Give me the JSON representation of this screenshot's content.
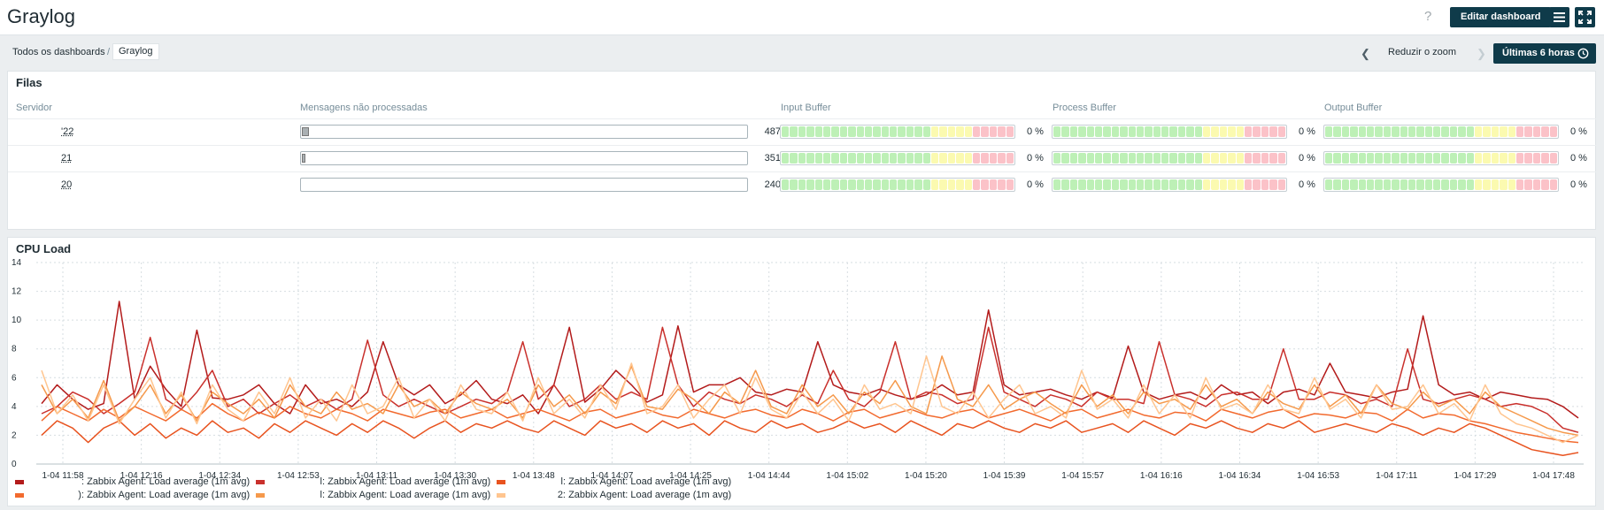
{
  "app": {
    "title": "Graylog"
  },
  "header": {
    "edit_label": "Editar dashboard",
    "help_label": "?"
  },
  "breadcrumb": {
    "root": "Todos os dashboards",
    "separator": "/",
    "current": "Graylog"
  },
  "timebar": {
    "zoom_label": "Reduzir o zoom",
    "range_label": "Últimas 6 horas"
  },
  "queues": {
    "title": "Filas",
    "headers": {
      "server": "Servidor",
      "messages": "Mensagens não processadas",
      "input": "Input Buffer",
      "process": "Process Buffer",
      "output": "Output Buffer"
    },
    "rows": [
      {
        "server": "'22",
        "messages": 487,
        "messages_label": "487",
        "input": "0 %",
        "process": "0 %",
        "output": "0 %",
        "fill_fraction": 0.015
      },
      {
        "server": "21",
        "messages": 351,
        "messages_label": "351",
        "input": "0 %",
        "process": "0 %",
        "output": "0 %",
        "fill_fraction": 0.008
      },
      {
        "server": "20",
        "messages": 240,
        "messages_label": "240",
        "input": "0 %",
        "process": "0 %",
        "output": "0 %",
        "fill_fraction": 0.0
      }
    ]
  },
  "cpu": {
    "title": "CPU Load",
    "legend": [
      {
        "prefix": ":",
        "text": "Zabbix Agent: Load average (1m avg)",
        "color": "#b31b1b"
      },
      {
        "prefix": "l:",
        "text": "Zabbix Agent: Load average (1m avg)",
        "color": "#c9302c"
      },
      {
        "prefix": "l:",
        "text": "Zabbix Agent: Load average (1m avg)",
        "color": "#e8531f"
      },
      {
        "prefix": "):",
        "text": "Zabbix Agent: Load average (1m avg)",
        "color": "#f26a2e"
      },
      {
        "prefix": "l:",
        "text": "Zabbix Agent: Load average (1m avg)",
        "color": "#f5994b"
      },
      {
        "prefix": "2:",
        "text": "Zabbix Agent: Load average (1m avg)",
        "color": "#ffc58f"
      }
    ]
  },
  "chart_data": {
    "type": "line",
    "ylim": [
      0,
      14
    ],
    "yticks": [
      "0",
      "2",
      "4",
      "6",
      "8",
      "10",
      "12",
      "14"
    ],
    "xticks": [
      "1-04 11:58",
      "1-04 12:16",
      "1-04 12:34",
      "1-04 12:53",
      "1-04 13:11",
      "1-04 13:30",
      "1-04 13:48",
      "1-04 14:07",
      "1-04 14:25",
      "1-04 14:44",
      "1-04 15:02",
      "1-04 15:20",
      "1-04 15:39",
      "1-04 15:57",
      "1-04 16:16",
      "1-04 16:34",
      "1-04 16:53",
      "1-04 17:11",
      "1-04 17:29",
      "1-04 17:48"
    ],
    "grid": true,
    "series": [
      {
        "color": "#b31b1b",
        "values": [
          4.2,
          5.5,
          4.5,
          3.8,
          4.2,
          11.3,
          4.5,
          6.8,
          5.2,
          4.0,
          9.3,
          4.6,
          4.5,
          4.8,
          5.5,
          4.2,
          3.5,
          5.5,
          4.2,
          4.5,
          4.0,
          5.0,
          8.5,
          5.5,
          4.8,
          5.5,
          4.2,
          4.8,
          5.8,
          4.5,
          4.2,
          4.8,
          3.5,
          5.5,
          9.5,
          4.3,
          5.2,
          6.5,
          5.5,
          4.3,
          4.8,
          9.6,
          5.0,
          5.5,
          5.5,
          6.0,
          5.0,
          4.8,
          5.2,
          5.0,
          8.5,
          5.5,
          5.0,
          4.8,
          5.2,
          4.8,
          4.5,
          4.8,
          5.5,
          4.8,
          5.0,
          10.7,
          5.5,
          4.8,
          5.0,
          5.2,
          4.8,
          4.5,
          5.0,
          4.6,
          8.2,
          5.0,
          4.5,
          4.8,
          5.0,
          4.5,
          5.5,
          4.8,
          5.0,
          4.2,
          5.0,
          5.2,
          4.8,
          7.0,
          5.0,
          4.8,
          4.6,
          5.0,
          5.2,
          10.3,
          5.5,
          4.8,
          5.0,
          4.5,
          5.0,
          4.8,
          4.6,
          4.5,
          4.0,
          3.2
        ]
      },
      {
        "color": "#c9302c",
        "values": [
          3.5,
          4.0,
          5.0,
          4.5,
          3.5,
          4.2,
          5.0,
          8.8,
          4.5,
          3.8,
          5.0,
          6.5,
          4.0,
          4.5,
          3.5,
          4.2,
          4.8,
          4.0,
          4.5,
          3.8,
          4.5,
          8.6,
          4.8,
          4.0,
          4.5,
          4.0,
          3.5,
          4.0,
          4.5,
          4.2,
          5.0,
          8.5,
          4.5,
          5.5,
          4.0,
          4.5,
          5.5,
          4.5,
          5.0,
          4.5,
          9.5,
          5.5,
          4.0,
          5.0,
          4.5,
          4.2,
          4.8,
          4.5,
          4.0,
          4.8,
          4.2,
          6.5,
          4.5,
          4.0,
          5.0,
          8.5,
          4.5,
          5.0,
          4.8,
          4.2,
          4.5,
          9.5,
          5.0,
          4.5,
          4.0,
          4.8,
          4.5,
          4.0,
          5.0,
          4.5,
          4.5,
          4.2,
          8.5,
          4.8,
          4.5,
          4.0,
          4.8,
          5.0,
          4.5,
          4.5,
          8.0,
          4.5,
          4.5,
          5.0,
          4.8,
          4.2,
          4.5,
          4.0,
          8.0,
          4.5,
          4.2,
          4.5,
          4.8,
          4.5,
          4.0,
          4.2,
          4.0,
          3.5,
          2.5,
          2.2
        ]
      },
      {
        "color": "#e8531f",
        "values": [
          2.0,
          3.0,
          2.5,
          1.5,
          2.5,
          3.0,
          2.0,
          2.8,
          1.8,
          2.5,
          2.0,
          3.0,
          2.2,
          2.5,
          1.8,
          2.8,
          2.2,
          3.0,
          2.5,
          2.0,
          2.8,
          2.2,
          3.0,
          2.5,
          1.8,
          2.5,
          3.0,
          2.2,
          2.8,
          2.5,
          3.0,
          2.5,
          2.2,
          3.0,
          2.5,
          2.0,
          3.0,
          2.5,
          2.8,
          2.2,
          3.0,
          2.5,
          2.8,
          2.0,
          3.0,
          2.5,
          2.2,
          3.0,
          2.5,
          2.8,
          2.2,
          2.5,
          3.0,
          2.5,
          2.8,
          2.2,
          3.0,
          2.5,
          2.0,
          2.8,
          2.5,
          3.0,
          2.5,
          2.2,
          2.8,
          2.5,
          3.0,
          2.2,
          2.5,
          2.8,
          2.2,
          3.0,
          2.5,
          2.0,
          2.8,
          2.5,
          3.0,
          2.5,
          2.2,
          2.8,
          2.5,
          3.0,
          2.2,
          2.5,
          2.8,
          2.5,
          2.2,
          2.8,
          2.5,
          2.0,
          2.5,
          2.2,
          2.8,
          2.5,
          2.0,
          1.5,
          1.0,
          0.8,
          0.6,
          0.8
        ]
      },
      {
        "color": "#f26a2e",
        "values": [
          3.0,
          4.0,
          3.5,
          3.0,
          3.8,
          3.2,
          4.0,
          3.5,
          3.0,
          3.8,
          3.2,
          4.2,
          3.5,
          3.0,
          3.6,
          3.2,
          4.0,
          3.5,
          3.2,
          3.8,
          3.5,
          3.0,
          3.8,
          3.5,
          3.2,
          3.6,
          3.8,
          3.2,
          3.5,
          3.8,
          3.2,
          3.5,
          3.8,
          3.4,
          3.0,
          3.6,
          3.8,
          3.2,
          3.5,
          3.8,
          3.4,
          3.2,
          3.8,
          3.5,
          3.2,
          3.6,
          3.8,
          3.4,
          3.2,
          3.8,
          3.5,
          3.0,
          3.6,
          3.8,
          3.2,
          3.5,
          3.8,
          3.4,
          3.2,
          3.6,
          3.8,
          3.2,
          3.5,
          3.8,
          3.4,
          3.0,
          3.6,
          3.8,
          3.2,
          3.5,
          3.8,
          3.4,
          3.2,
          3.6,
          3.5,
          3.0,
          3.8,
          3.5,
          3.2,
          3.6,
          3.8,
          3.2,
          3.5,
          3.4,
          3.2,
          3.6,
          3.5,
          3.0,
          3.8,
          3.2,
          3.5,
          3.4,
          3.0,
          2.8,
          2.5,
          2.2,
          2.0,
          1.8,
          1.6,
          1.5
        ]
      },
      {
        "color": "#f5994b",
        "values": [
          5.5,
          3.5,
          4.5,
          3.2,
          5.8,
          3.0,
          4.0,
          5.5,
          3.5,
          4.8,
          3.0,
          5.0,
          4.2,
          3.5,
          4.5,
          3.2,
          5.5,
          4.0,
          3.5,
          5.0,
          3.8,
          4.2,
          3.5,
          5.5,
          4.0,
          4.5,
          3.5,
          5.0,
          4.2,
          3.8,
          4.5,
          3.2,
          5.5,
          4.0,
          4.8,
          3.5,
          5.0,
          4.2,
          6.8,
          4.0,
          3.8,
          5.2,
          4.5,
          3.5,
          5.0,
          4.2,
          6.5,
          4.0,
          3.5,
          5.5,
          4.0,
          4.8,
          3.5,
          5.0,
          4.2,
          5.8,
          4.0,
          3.5,
          7.5,
          4.5,
          4.0,
          5.5,
          3.8,
          4.5,
          5.0,
          4.2,
          3.5,
          5.5,
          4.0,
          4.8,
          3.5,
          5.0,
          4.2,
          4.5,
          3.8,
          5.5,
          4.0,
          4.5,
          3.5,
          5.0,
          4.2,
          3.8,
          5.5,
          4.0,
          4.8,
          3.5,
          5.5,
          4.2,
          3.8,
          5.0,
          4.0,
          4.5,
          3.5,
          5.0,
          4.0,
          3.5,
          3.0,
          2.5,
          2.2,
          2.0
        ]
      },
      {
        "color": "#ffc58f",
        "values": [
          6.5,
          3.5,
          4.8,
          3.0,
          5.5,
          2.8,
          4.5,
          6.0,
          3.2,
          5.0,
          2.8,
          5.5,
          3.8,
          3.0,
          5.0,
          3.5,
          6.0,
          3.2,
          4.5,
          3.0,
          5.5,
          3.5,
          4.0,
          6.0,
          3.2,
          4.5,
          3.0,
          5.5,
          3.8,
          3.5,
          5.0,
          3.0,
          6.0,
          3.5,
          4.5,
          3.2,
          5.5,
          3.8,
          7.0,
          3.5,
          4.0,
          5.5,
          3.2,
          4.5,
          5.5,
          3.5,
          6.0,
          3.8,
          3.2,
          5.0,
          3.5,
          4.5,
          3.0,
          5.5,
          3.8,
          4.2,
          3.5,
          7.5,
          4.0,
          3.5,
          5.0,
          3.2,
          4.5,
          5.5,
          3.5,
          4.0,
          3.2,
          6.5,
          3.8,
          4.5,
          3.2,
          5.5,
          3.5,
          4.8,
          3.2,
          6.0,
          3.8,
          4.2,
          3.5,
          5.5,
          3.8,
          3.5,
          6.0,
          3.8,
          4.5,
          3.2,
          5.5,
          3.8,
          4.0,
          5.5,
          3.5,
          4.2,
          3.0,
          5.5,
          3.5,
          2.8,
          2.5,
          2.0,
          1.5,
          2.0
        ]
      }
    ]
  }
}
